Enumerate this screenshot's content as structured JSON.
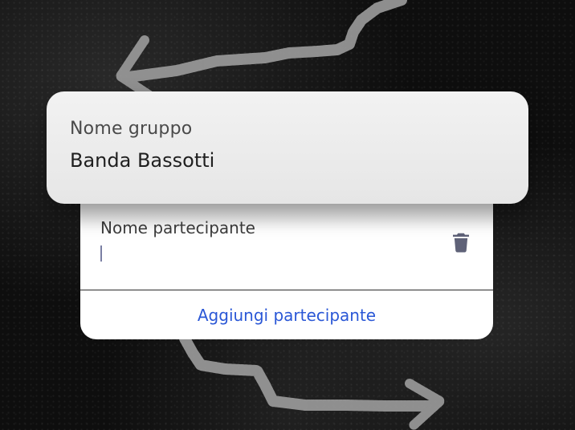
{
  "group": {
    "label": "Nome gruppo",
    "value": "Banda Bassotti"
  },
  "participant": {
    "label": "Nome partecipante",
    "value": "",
    "delete_icon": "trash-icon"
  },
  "actions": {
    "add_participant": "Aggiungi partecipante"
  },
  "colors": {
    "accent": "#2a57d6",
    "icon": "#5f6278",
    "background": "#0e0e0e"
  }
}
